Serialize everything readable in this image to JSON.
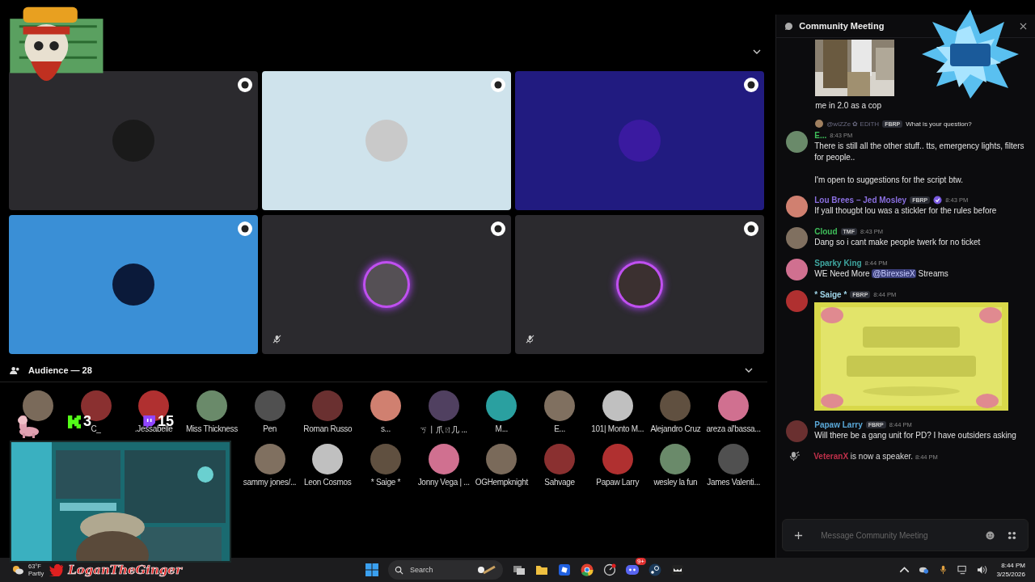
{
  "stage": {
    "tiles": [
      {
        "color": "#2b2a2e",
        "speaking": false,
        "muted": false
      },
      {
        "color": "#cfe3ec",
        "speaking": false,
        "muted": false
      },
      {
        "color": "#211b80",
        "speaking": false,
        "muted": false
      },
      {
        "color": "#3a8fd6",
        "speaking": false,
        "muted": false
      },
      {
        "color": "#2b2a2e",
        "speaking": true,
        "muted": true
      },
      {
        "color": "#2b2a2e",
        "speaking": true,
        "muted": true
      }
    ]
  },
  "audience": {
    "title": "Audience — 28",
    "rows": [
      [
        "",
        "C_",
        ".Jessabelle",
        "Miss Thickness",
        "Pen",
        "Roman Russo",
        "s...",
        "ㄎ丨爪ㄖ几 ...",
        "M...",
        "E...",
        "101| Monto M...",
        "Alejandro Cruz",
        "areza al'bassa..."
      ],
      [
        "",
        "",
        "",
        "",
        "sammy jones/...",
        "Leon Cosmos",
        "* Saige *",
        "Jonny Vega | ...",
        "OGHempknight",
        "Sahvage",
        "Papaw Larry",
        "wesley la fun",
        "James Valenti..."
      ]
    ]
  },
  "overlay": {
    "kick_count": "3",
    "twitch_count": "15",
    "handle": "LoganTheGinger"
  },
  "chat": {
    "title": "Community Meeting",
    "messages": [
      {
        "kind": "continuation",
        "text": "me in 2.0 as a cop"
      },
      {
        "kind": "message",
        "author": "E...",
        "color": "#3fbf5a",
        "time": "8:43 PM",
        "reply": {
          "mention": "@wiZZe ✿ EDiTH",
          "tag": "FBRP",
          "text": "What is your question?"
        },
        "paragraphs": [
          "There is still all the other stuff.. tts, emergency lights, filters for people..",
          "I'm open to suggestions for the script btw."
        ]
      },
      {
        "kind": "message",
        "author": "Lou Brees – Jed Mosley",
        "color": "#8a6fe0",
        "tag": "FBRP",
        "verified": true,
        "time": "8:43 PM",
        "paragraphs": [
          "If yall thougbt lou was a stickler for the rules before"
        ]
      },
      {
        "kind": "message",
        "author": "Cloud",
        "color": "#3fbf5a",
        "tag": "TMF",
        "time": "8:43 PM",
        "paragraphs": [
          "Dang so i cant make people twerk for no ticket"
        ]
      },
      {
        "kind": "message",
        "author": "Sparky King",
        "color": "#3fa7a0",
        "time": "8:44 PM",
        "parts": [
          {
            "kind": "text",
            "text": "WE Need More "
          },
          {
            "kind": "mention",
            "text": "@BirexsieX"
          },
          {
            "kind": "text",
            "text": " Streams"
          }
        ]
      },
      {
        "author": "* Saige *",
        "color": "#9fd4e8",
        "tag": "FBRP",
        "time": "8:44 PM"
      },
      {
        "kind": "message",
        "author": "Papaw Larry",
        "color": "#5aa8d8",
        "tag": "FBRP",
        "time": "8:44 PM",
        "paragraphs": [
          "Will there be a gang unit for PD? I have outsiders asking"
        ]
      },
      {
        "kind": "system",
        "author": "VeteranX",
        "color": "#c0304a",
        "text": "is now a speaker.",
        "time": "8:44 PM"
      }
    ],
    "input": {
      "placeholder": "Message Community Meeting"
    }
  },
  "taskbar": {
    "weather": {
      "temp": "63°F",
      "condition": "Partly"
    },
    "search": {
      "placeholder": "Search"
    },
    "discord_badge": "9+",
    "time": "8:44 PM",
    "date": "3/25/2026"
  }
}
